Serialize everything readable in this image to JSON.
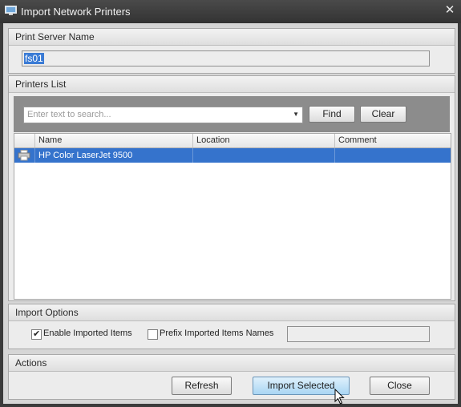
{
  "window": {
    "title": "Import Network Printers"
  },
  "print_server": {
    "header": "Print Server Name",
    "value": "fs01"
  },
  "printers": {
    "header": "Printers List",
    "search_placeholder": "Enter text to search...",
    "find_label": "Find",
    "clear_label": "Clear",
    "columns": [
      "Name",
      "Location",
      "Comment"
    ],
    "rows": [
      {
        "name": "HP Color LaserJet 9500",
        "location": "",
        "comment": "",
        "selected": true
      }
    ]
  },
  "import_options": {
    "header": "Import Options",
    "enable_label": "Enable Imported Items",
    "enable_checked": true,
    "prefix_label": "Prefix Imported Items Names",
    "prefix_checked": false,
    "prefix_value": ""
  },
  "actions": {
    "header": "Actions",
    "refresh_label": "Refresh",
    "import_label": "Import Selected",
    "close_label": "Close"
  },
  "colors": {
    "selection": "#3573cc",
    "primary_button": "#a9d5f3",
    "title_bar": "#3b3b3b"
  }
}
